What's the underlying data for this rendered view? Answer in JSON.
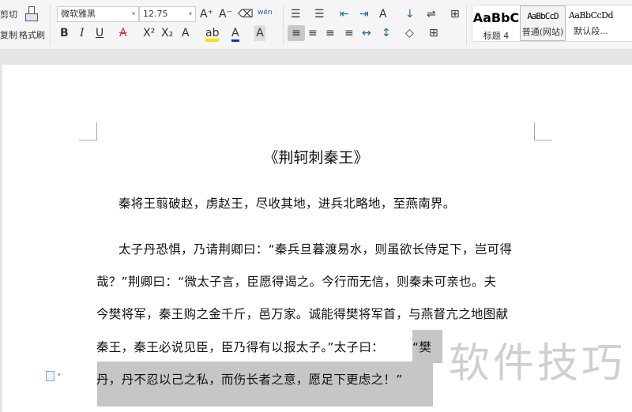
{
  "toolbar": {
    "cut": "剪切",
    "copy": "复制",
    "format_painter": "格式刷",
    "font_name": "微软雅黑",
    "font_size": "12.75",
    "bold": "B",
    "italic": "I",
    "underline": "U",
    "strike": "A",
    "superscript": "X²",
    "subscript": "X₂",
    "text_effect": "A",
    "highlight": "ab",
    "font_color": "A",
    "char_shading": "A",
    "grow": "A⁺",
    "shrink": "A⁻",
    "phonetic": "wén"
  },
  "styles": [
    {
      "preview": "AaBbC",
      "label": "标题 4"
    },
    {
      "preview": "AaBbCcD",
      "label": "普通(网站)"
    },
    {
      "preview": "AaBbCcDd",
      "label": "默认段..."
    }
  ],
  "colors": {
    "highlight": "#f5e400",
    "font_color": "#1a2fbf",
    "selection": "#c6c6c6"
  },
  "document": {
    "title": "《荆轲刺秦王》",
    "lines": [
      "秦将王翦破赵，虏赵王，尽收其地，进兵北略地，至燕南界。",
      "太子丹恐惧，乃请荆卿曰：“秦兵旦暮渡易水，则虽欲长侍足下，岂可得",
      "哉？”荆卿曰：“微太子言，臣愿得谒之。今行而无信，则秦未可亲也。夫",
      "今樊将军，秦王购之金千斤，邑万家。诚能得樊将军首，与燕督亢之地图献",
      "秦王，秦王必说见臣，臣乃得有以报太子。”太子曰：",
      "“樊",
      "丹，丹不忍以己之私，而伤长者之意，愿足下更虑之！”"
    ]
  },
  "watermark": "软件技巧"
}
